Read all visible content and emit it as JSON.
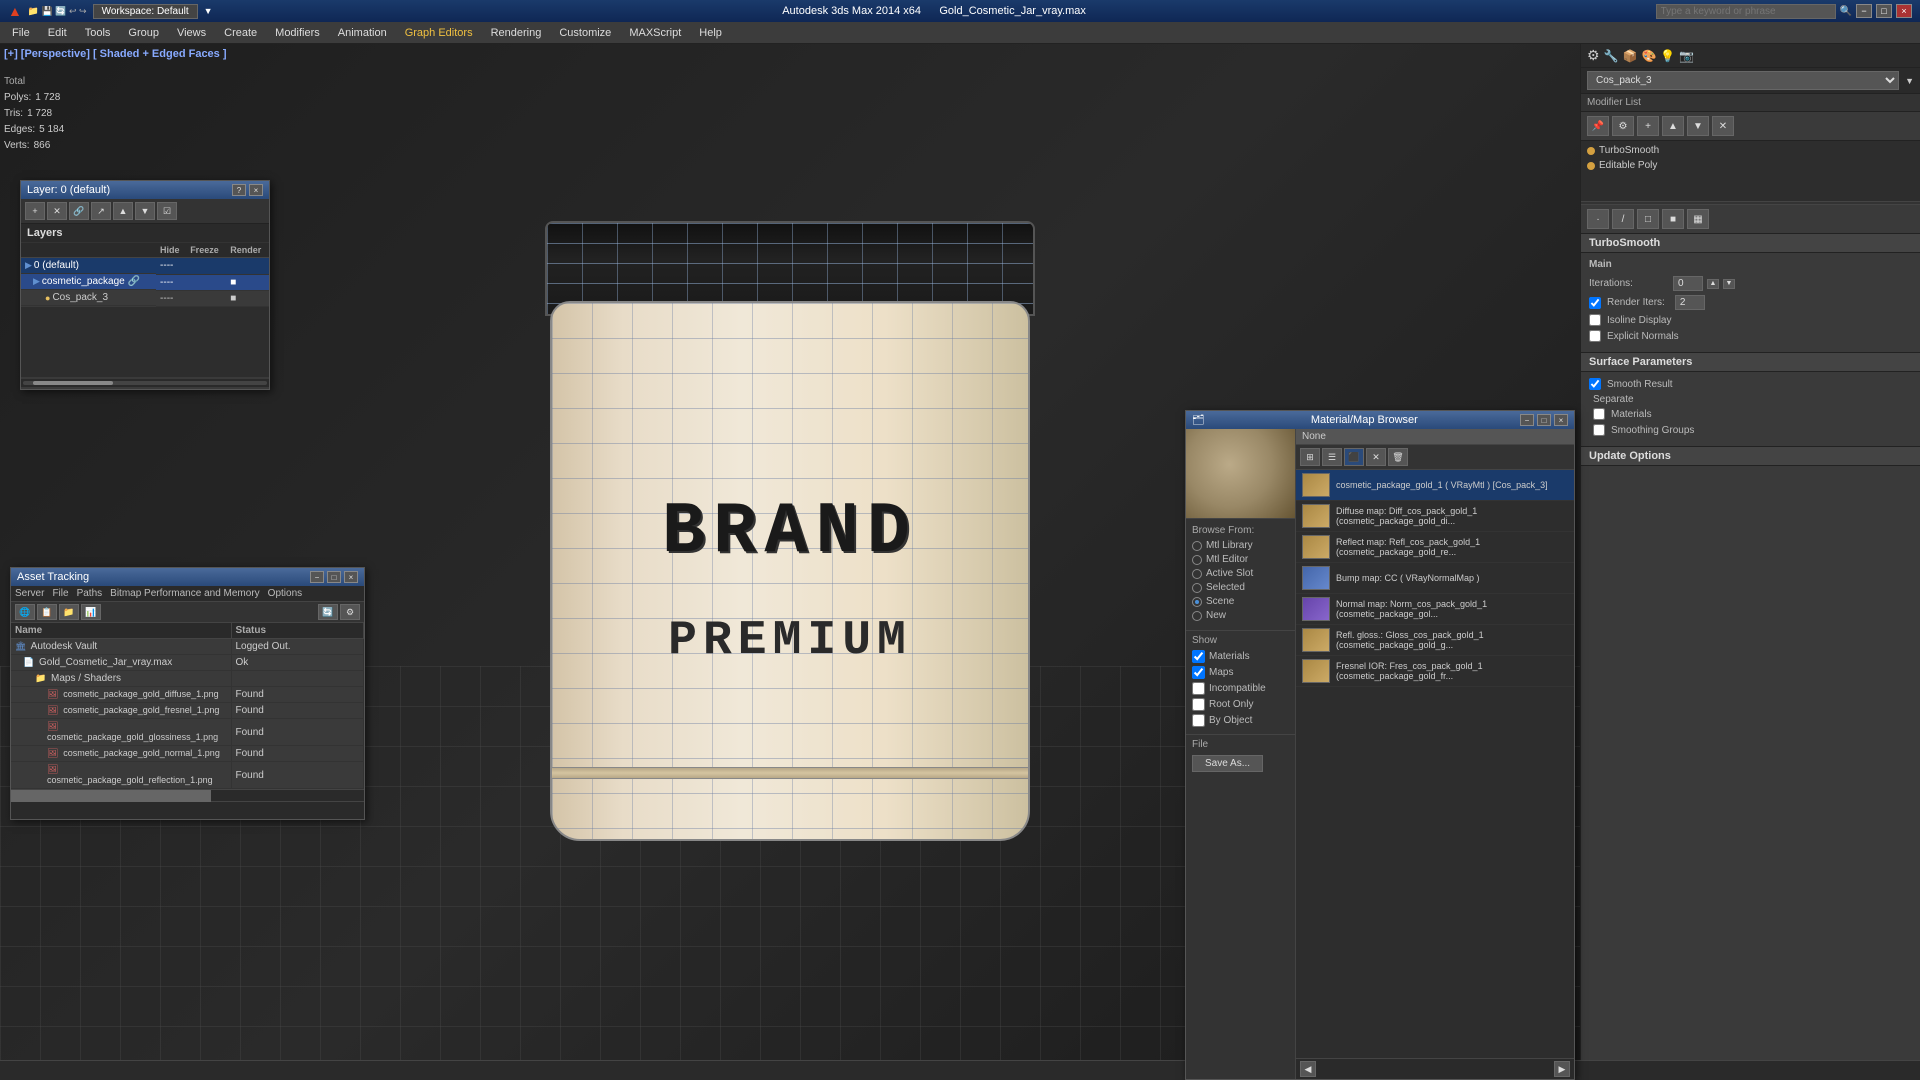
{
  "titlebar": {
    "app_name": "Autodesk 3ds Max 2014 x64",
    "file_name": "Gold_Cosmetic_Jar_vray.max",
    "workspace_label": "Workspace: Default",
    "search_placeholder": "Type a keyword or phrase",
    "min_label": "−",
    "max_label": "□",
    "close_label": "×"
  },
  "menubar": {
    "items": [
      {
        "label": "Edit"
      },
      {
        "label": "Tools"
      },
      {
        "label": "Group"
      },
      {
        "label": "Views"
      },
      {
        "label": "Create"
      },
      {
        "label": "Modifiers"
      },
      {
        "label": "Animation"
      },
      {
        "label": "Graph Editors"
      },
      {
        "label": "Rendering"
      },
      {
        "label": "Customize"
      },
      {
        "label": "MAXScript"
      },
      {
        "label": "Help"
      }
    ]
  },
  "viewport": {
    "label": "[+] [Perspective] [ Shaded + Edged Faces ]",
    "stats": {
      "polys_label": "Polys:",
      "polys_value": "1 728",
      "tris_label": "Tris:",
      "tris_value": "1 728",
      "edges_label": "Edges:",
      "edges_value": "5 184",
      "verts_label": "Verts:",
      "verts_value": "866",
      "total_label": "Total"
    },
    "jar": {
      "brand_text": "BRAND",
      "premium_text": "PREMIUM"
    }
  },
  "right_panel": {
    "modifier_dropdown": "Cos_pack_3",
    "modifier_list_label": "Modifier List",
    "modifiers": [
      {
        "name": "TurboSmooth",
        "active": false,
        "dot": "yellow"
      },
      {
        "name": "Editable Poly",
        "active": false,
        "dot": "yellow"
      }
    ],
    "turbosmooth": {
      "title": "TurboSmooth",
      "main_label": "Main",
      "iterations_label": "Iterations:",
      "iterations_value": "0",
      "render_iters_label": "Render Iters:",
      "render_iters_value": "2",
      "isoline_label": "Isoline Display",
      "explicit_label": "Explicit Normals",
      "surface_params_label": "Surface Parameters",
      "smooth_result_label": "Smooth Result",
      "smooth_result_checked": true,
      "separate_label": "Separate",
      "materials_label": "Materials",
      "smoothing_groups_label": "Smoothing Groups",
      "update_options_label": "Update Options"
    }
  },
  "layers_panel": {
    "title": "Layer: 0 (default)",
    "layers_label": "Layers",
    "columns": [
      "",
      "Hide",
      "Freeze",
      "Render"
    ],
    "rows": [
      {
        "indent": 0,
        "icon": "folder",
        "name": "0 (default)",
        "hide": "----",
        "freeze": "",
        "render": ""
      },
      {
        "indent": 1,
        "icon": "layer",
        "name": "cosmetic_package",
        "selected": true,
        "hide": "----",
        "freeze": "",
        "render": "■"
      },
      {
        "indent": 2,
        "icon": "object",
        "name": "Cos_pack_3",
        "hide": "----",
        "freeze": "",
        "render": "■"
      }
    ]
  },
  "asset_panel": {
    "title": "Asset Tracking",
    "menu_items": [
      "Server",
      "File",
      "Paths",
      "Bitmap Performance and Memory",
      "Options"
    ],
    "columns": [
      "Name",
      "Status"
    ],
    "rows": [
      {
        "indent": 0,
        "icon": "vault",
        "name": "Autodesk Vault",
        "status": "Logged Out.",
        "status_class": "logged-out"
      },
      {
        "indent": 1,
        "icon": "file",
        "name": "Gold_Cosmetic_Jar_vray.max",
        "status": "Ok",
        "status_class": "found"
      },
      {
        "indent": 2,
        "icon": "folder",
        "name": "Maps / Shaders",
        "status": "",
        "status_class": ""
      },
      {
        "indent": 3,
        "icon": "map",
        "name": "cosmetic_package_gold_diffuse_1.png",
        "status": "Found",
        "status_class": "found"
      },
      {
        "indent": 3,
        "icon": "map",
        "name": "cosmetic_package_gold_fresnel_1.png",
        "status": "Found",
        "status_class": "found"
      },
      {
        "indent": 3,
        "icon": "map",
        "name": "cosmetic_package_gold_glossiness_1.png",
        "status": "Found",
        "status_class": "found"
      },
      {
        "indent": 3,
        "icon": "map",
        "name": "cosmetic_package_gold_normal_1.png",
        "status": "Found",
        "status_class": "found"
      },
      {
        "indent": 3,
        "icon": "map",
        "name": "cosmetic_package_gold_reflection_1.png",
        "status": "Found",
        "status_class": "found"
      }
    ]
  },
  "mat_browser": {
    "title": "Material/Map Browser",
    "none_label": "None",
    "browse_from_label": "Browse From:",
    "browse_options": [
      "Mtl Library",
      "Mtl Editor",
      "Active Slot",
      "Selected",
      "Scene",
      "New"
    ],
    "browse_selected": "Scene",
    "show_label": "Show",
    "show_options": [
      "Materials",
      "Maps",
      "Incompatible"
    ],
    "show_materials_checked": true,
    "show_maps_checked": true,
    "show_incompatible_checked": false,
    "root_only_label": "Root Only",
    "root_only_checked": false,
    "by_object_label": "By Object",
    "by_object_checked": false,
    "file_label": "File",
    "save_as_label": "Save As...",
    "items": [
      {
        "name": "cosmetic_package_gold_1 ( VRayMtl ) [Cos_pack_3]",
        "type": "gold",
        "selected": true
      },
      {
        "name": "Diffuse map: Diff_cos_pack_gold_1 (cosmetic_package_gold_di...",
        "type": "gold",
        "selected": false
      },
      {
        "name": "Reflect map: Refl_cos_pack_gold_1 (cosmetic_package_gold_re...",
        "type": "gold",
        "selected": false
      },
      {
        "name": "Bump map: CC ( VRayNormalMap )",
        "type": "blue",
        "selected": false
      },
      {
        "name": "Normal map: Norm_cos_pack_gold_1 (cosmetic_package_gol...",
        "type": "purple",
        "selected": false
      },
      {
        "name": "Refl. gloss.: Gloss_cos_pack_gold_1 (cosmetic_package_gold_g...",
        "type": "gold",
        "selected": false
      },
      {
        "name": "Fresnel IOR: Fres_cos_pack_gold_1 (cosmetic_package_gold_fr...",
        "type": "gold",
        "selected": false
      }
    ]
  },
  "status_bar": {
    "text": ""
  }
}
